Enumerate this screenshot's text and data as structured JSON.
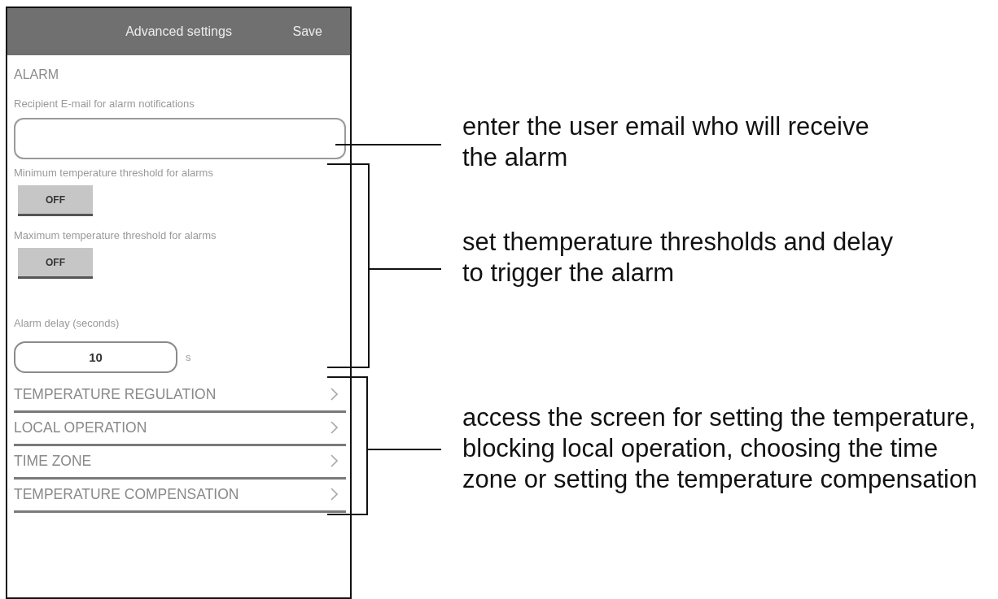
{
  "app_bar": {
    "title": "Advanced settings",
    "action": "Save"
  },
  "alarm": {
    "title": "ALARM",
    "settings": [
      {
        "kind": "email",
        "label": "Recipient E-mail for alarm notifications"
      },
      {
        "kind": "toggle",
        "label": "Minimum temperature threshold for alarms",
        "value": "OFF",
        "on": false
      },
      {
        "kind": "toggle",
        "label": "Maximum temperature threshold for alarms",
        "value": "OFF",
        "on": false
      },
      {
        "kind": "number",
        "label": "Alarm delay (seconds)",
        "value": "10",
        "unit": "s"
      }
    ]
  },
  "menu": [
    {
      "label": "TEMPERATURE REGULATION"
    },
    {
      "label": "LOCAL OPERATION"
    },
    {
      "label": "TIME ZONE"
    },
    {
      "label": "TEMPERATURE COMPENSATION"
    }
  ],
  "callouts": [
    {
      "kind": "leader",
      "text": "enter the user email who will receive\nthe alarm"
    },
    {
      "kind": "bracket",
      "text": "set themperature thresholds and delay\nto trigger the alarm"
    },
    {
      "kind": "bracket",
      "text": "access the screen for setting the temperature,\nblocking local operation, choosing the time\nzone or setting the temperature compensation"
    }
  ]
}
